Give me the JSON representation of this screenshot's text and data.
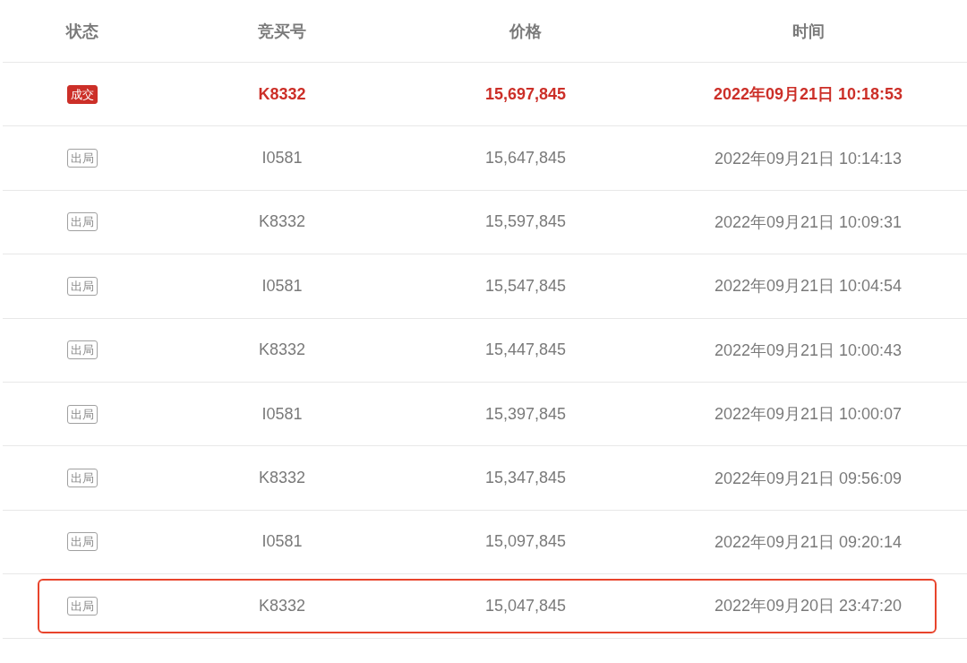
{
  "table": {
    "columns": [
      "状态",
      "竞买号",
      "价格",
      "时间"
    ],
    "rows": [
      {
        "status": {
          "label": "成交",
          "kind": "deal"
        },
        "bidder": "K8332",
        "price": "15,697,845",
        "time": "2022年09月21日 10:18:53",
        "highlighted": false
      },
      {
        "status": {
          "label": "出局",
          "kind": "out"
        },
        "bidder": "I0581",
        "price": "15,647,845",
        "time": "2022年09月21日 10:14:13",
        "highlighted": false
      },
      {
        "status": {
          "label": "出局",
          "kind": "out"
        },
        "bidder": "K8332",
        "price": "15,597,845",
        "time": "2022年09月21日 10:09:31",
        "highlighted": false
      },
      {
        "status": {
          "label": "出局",
          "kind": "out"
        },
        "bidder": "I0581",
        "price": "15,547,845",
        "time": "2022年09月21日 10:04:54",
        "highlighted": false
      },
      {
        "status": {
          "label": "出局",
          "kind": "out"
        },
        "bidder": "K8332",
        "price": "15,447,845",
        "time": "2022年09月21日 10:00:43",
        "highlighted": false
      },
      {
        "status": {
          "label": "出局",
          "kind": "out"
        },
        "bidder": "I0581",
        "price": "15,397,845",
        "time": "2022年09月21日 10:00:07",
        "highlighted": false
      },
      {
        "status": {
          "label": "出局",
          "kind": "out"
        },
        "bidder": "K8332",
        "price": "15,347,845",
        "time": "2022年09月21日 09:56:09",
        "highlighted": false
      },
      {
        "status": {
          "label": "出局",
          "kind": "out"
        },
        "bidder": "I0581",
        "price": "15,097,845",
        "time": "2022年09月21日 09:20:14",
        "highlighted": false
      },
      {
        "status": {
          "label": "出局",
          "kind": "out"
        },
        "bidder": "K8332",
        "price": "15,047,845",
        "time": "2022年09月20日 23:47:20",
        "highlighted": true
      }
    ]
  }
}
